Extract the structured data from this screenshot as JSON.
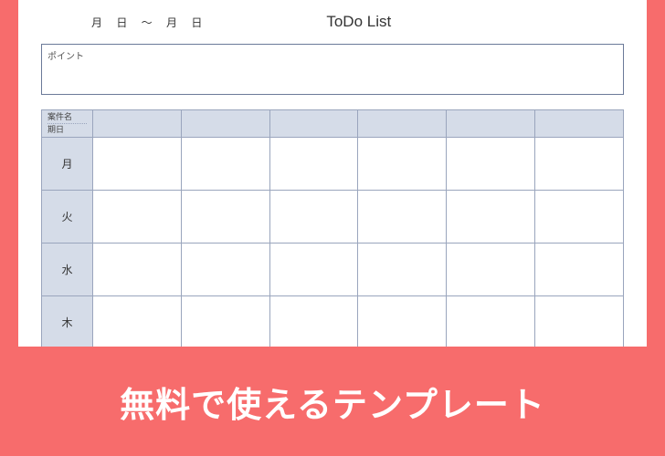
{
  "header": {
    "date_range": "月 日 ～  月 日",
    "title": "ToDo List"
  },
  "point_box": {
    "label": "ポイント"
  },
  "table": {
    "corner_header_line1": "案件名",
    "corner_header_line2": "期日",
    "columns": [
      "",
      "",
      "",
      "",
      "",
      ""
    ],
    "days": [
      "月",
      "火",
      "水",
      "木"
    ]
  },
  "banner": {
    "text": "無料で使えるテンプレート"
  }
}
